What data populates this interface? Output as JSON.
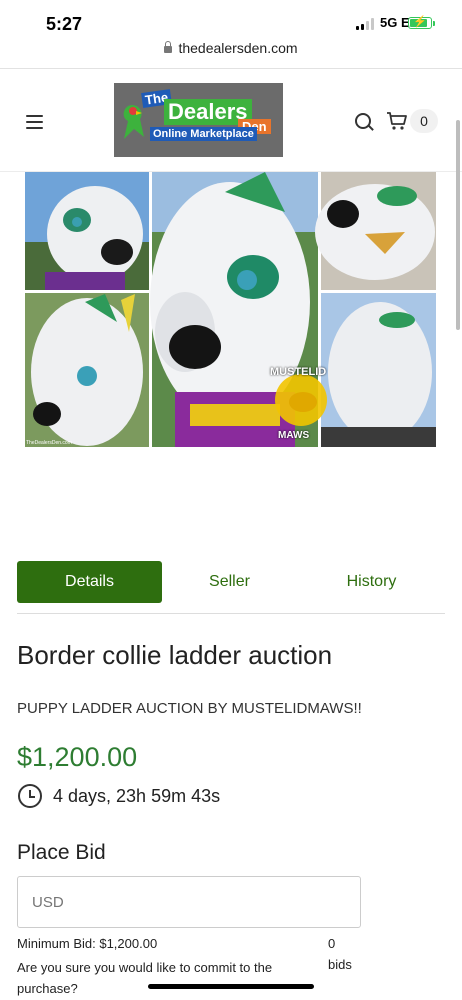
{
  "status_bar": {
    "time": "5:27",
    "network": "5G E"
  },
  "browser": {
    "url": "thedealersden.com"
  },
  "header": {
    "logo": {
      "line1": "The",
      "line2": "Dealers",
      "line3": "Den",
      "line4": "Online Marketplace"
    },
    "cart_count": "0"
  },
  "product_image": {
    "watermark_top": "MUSTELID",
    "watermark_bottom": "MAWS",
    "credit": "TheDealersDen.com"
  },
  "tabs": [
    {
      "label": "Details",
      "active": true
    },
    {
      "label": "Seller",
      "active": false
    },
    {
      "label": "History",
      "active": false
    }
  ],
  "listing": {
    "title": "Border collie ladder auction",
    "subtitle": "PUPPY LADDER AUCTION BY MUSTELIDMAWS!!",
    "price": "$1,200.00",
    "time_left": "4 days, 23h 59m 43s"
  },
  "bid": {
    "heading": "Place Bid",
    "placeholder": "USD",
    "minimum": "Minimum Bid: $1,200.00",
    "confirm": "Are you sure you would like to commit to the purchase?",
    "bid_count": "0",
    "bid_label": "bids"
  },
  "colors": {
    "accent": "#2e6e0f",
    "price": "#2e7d32"
  }
}
